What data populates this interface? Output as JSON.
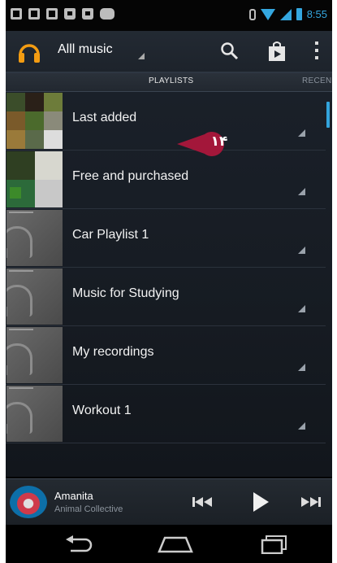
{
  "status_bar": {
    "time": "8:55",
    "left_icons": [
      "message-icon",
      "chat-icon",
      "screenshot-icon",
      "store-bag-icon",
      "store-bag-icon",
      "gamepad-icon"
    ],
    "right_icons": [
      "bluetooth-icon",
      "wifi-icon",
      "signal-icon",
      "battery-icon"
    ],
    "accent": "#34a7e0"
  },
  "action_bar": {
    "title": "Alll music",
    "icons": [
      "headphones-icon",
      "search-icon",
      "store-icon",
      "overflow-menu-icon"
    ]
  },
  "tabs": {
    "active": "PLAYLISTS",
    "next": "RECEN"
  },
  "playlists": [
    {
      "label": "Last added",
      "art": "mosaic"
    },
    {
      "label": "Free and purchased",
      "art": "mosaic"
    },
    {
      "label": "Car Playlist 1",
      "art": "default"
    },
    {
      "label": "Music for Studying",
      "art": "default"
    },
    {
      "label": "My recordings",
      "art": "default"
    },
    {
      "label": "Workout 1",
      "art": "default"
    }
  ],
  "annotation": {
    "number": "۱۴",
    "color": "#a3173a"
  },
  "now_playing": {
    "title": "Amanita",
    "artist": "Animal Collective",
    "controls": [
      "previous-icon",
      "play-icon",
      "next-icon"
    ]
  },
  "nav_bar": {
    "buttons": [
      "back-icon",
      "home-icon",
      "recent-apps-icon"
    ]
  }
}
